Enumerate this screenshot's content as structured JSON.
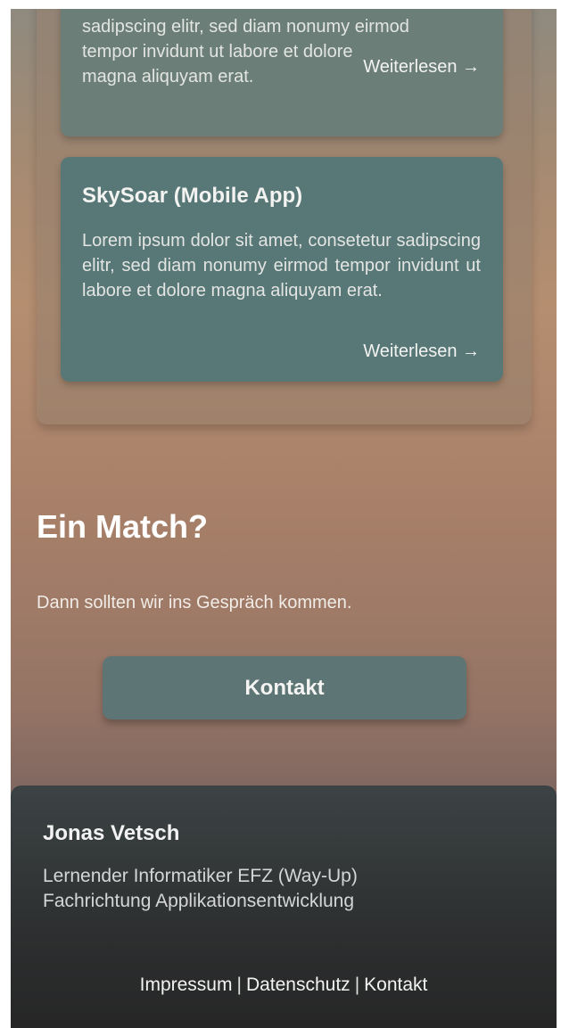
{
  "projects": {
    "card1": {
      "text_line1": "sadipscing elitr, sed diam nonumy eirmod",
      "text_line2": "tempor invidunt ut labore et dolore",
      "text_line3": "magna aliquyam erat.",
      "read_more": "Weiterlesen →"
    },
    "card2": {
      "title": "SkySoar (Mobile App)",
      "text": "Lorem ipsum dolor sit amet, consetetur sadipscing elitr, sed diam nonumy eirmod tempor invidunt ut labore et dolore magna aliquyam erat.",
      "read_more": "Weiterlesen →"
    }
  },
  "match": {
    "title": "Ein Match?",
    "subtitle": "Dann sollten wir ins Gespräch kommen.",
    "button": "Kontakt"
  },
  "footer": {
    "name": "Jonas Vetsch",
    "role_line1": "Lernender Informatiker EFZ (Way-Up)",
    "role_line2": "Fachrichtung Applikationsentwicklung",
    "links": {
      "impressum": "Impressum",
      "datenschutz": "Datenschutz",
      "kontakt": "Kontakt",
      "separator": "|"
    }
  }
}
